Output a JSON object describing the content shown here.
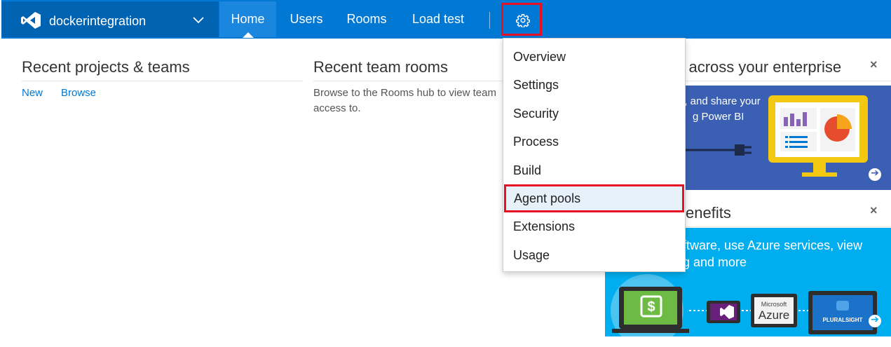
{
  "header": {
    "account_name": "dockerintegration",
    "nav": {
      "home": "Home",
      "users": "Users",
      "rooms": "Rooms",
      "load_test": "Load test"
    },
    "settings_icon": "gear-icon",
    "brand_color": "#0078d4"
  },
  "recent_projects": {
    "title": "Recent projects & teams",
    "new_link": "New",
    "browse_link": "Browse"
  },
  "recent_rooms": {
    "title": "Recent team rooms",
    "line1": "Browse to the Rooms hub to view team",
    "line2": "access to."
  },
  "powerbi_panel": {
    "title": "ta across your enterprise",
    "line1": "e, and share your",
    "line2": "g Power BI"
  },
  "benefits_panel": {
    "title": "enefits",
    "line1": "ftware, use Azure services, view",
    "line2": "g and more",
    "logo_microsoft": "Microsoft",
    "logo_azure": "Azure",
    "logo_pluralsight": "PLURALSIGHT"
  },
  "settings_menu": {
    "items": [
      {
        "label": "Overview"
      },
      {
        "label": "Settings"
      },
      {
        "label": "Security"
      },
      {
        "label": "Process"
      },
      {
        "label": "Build"
      },
      {
        "label": "Agent pools",
        "selected": true
      },
      {
        "label": "Extensions"
      },
      {
        "label": "Usage"
      }
    ]
  }
}
